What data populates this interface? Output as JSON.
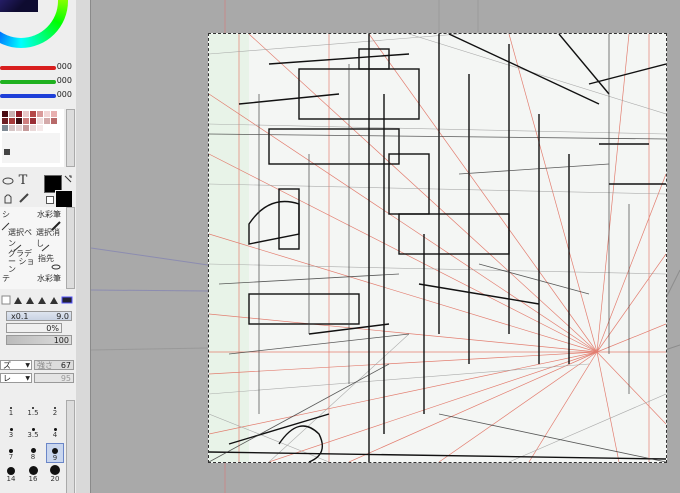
{
  "colors": {
    "panel_bg": "#eeeeee",
    "canvas_bg": "#a9a9a9",
    "paper_bg": "#f4f6f4",
    "red_slider": "#d81e1e",
    "green_slider": "#1fb11f",
    "blue_slider": "#1e3fd8",
    "perspective_line": "#e06a5a"
  },
  "color_panel": {
    "red_value": "000",
    "green_value": "000",
    "blue_value": "000"
  },
  "tools": {
    "text_tool_label": "T"
  },
  "brush_tools": [
    {
      "label": "シ"
    },
    {
      "label": "水彩筆"
    },
    {
      "label": "",
      "icon": "pen-icon"
    },
    {
      "label": "",
      "icon": "brush-icon"
    },
    {
      "label": "選択ペン"
    },
    {
      "label": "選択消し"
    },
    {
      "label": "グラデー ション"
    },
    {
      "label": "指先"
    },
    {
      "label": "テ"
    },
    {
      "label": "水彩筆"
    }
  ],
  "brush_settings": {
    "size_multiplier": "x0.1",
    "size_value": "9.0",
    "min_size": "0%",
    "density": "100",
    "blend_label": "ズ",
    "strength_label": "強さ",
    "strength_value": "67",
    "second_label": "レ",
    "second_value": "95"
  },
  "brush_sizes": [
    {
      "label": "1",
      "dot": 2
    },
    {
      "label": "1.5",
      "dot": 2
    },
    {
      "label": "2",
      "dot": 2
    },
    {
      "label": "3",
      "dot": 3
    },
    {
      "label": "3.5",
      "dot": 3
    },
    {
      "label": "4",
      "dot": 3
    },
    {
      "label": "7",
      "dot": 4
    },
    {
      "label": "8",
      "dot": 5
    },
    {
      "label": "9",
      "dot": 6
    },
    {
      "label": "14",
      "dot": 8
    },
    {
      "label": "16",
      "dot": 9
    },
    {
      "label": "20",
      "dot": 10
    }
  ],
  "selected_brush_size": "9"
}
